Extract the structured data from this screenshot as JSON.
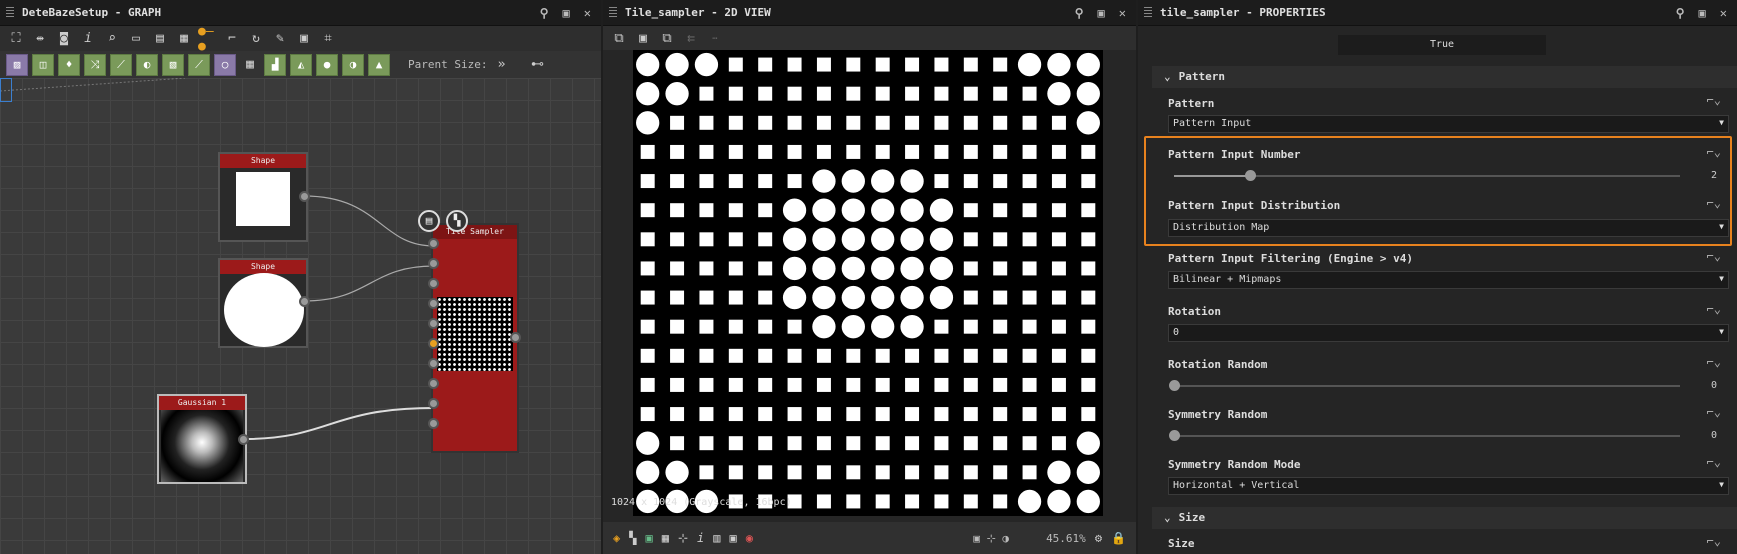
{
  "graph": {
    "title": "DeteBazeSetup - GRAPH",
    "parent_size": "Parent Size:",
    "nodes": {
      "shape1": "Shape",
      "shape2": "Shape",
      "gaussian": "Gaussian 1",
      "tile_sampler": "Tile Sampler"
    }
  },
  "view": {
    "title": "Tile_sampler - 2D VIEW",
    "resolution": "1024 x 1024 (Grayscale, 16bpc)",
    "zoom": "45.61%"
  },
  "props": {
    "title": "tile_sampler - PROPERTIES",
    "top_value": "True",
    "section_pattern": "Pattern",
    "pattern_label": "Pattern",
    "pattern_value": "Pattern Input",
    "input_number_label": "Pattern Input Number",
    "input_number_value": "2",
    "input_number_fraction": 0.15,
    "distribution_label": "Pattern Input Distribution",
    "distribution_value": "Distribution Map",
    "filtering_label": "Pattern Input Filtering (Engine > v4)",
    "filtering_value": "Bilinear + Mipmaps",
    "rotation_label": "Rotation",
    "rotation_value": "0",
    "rotation_random_label": "Rotation Random",
    "rotation_random_value": "0",
    "symmetry_random_label": "Symmetry Random",
    "symmetry_random_value": "0",
    "symmetry_mode_label": "Symmetry Random Mode",
    "symmetry_mode_value": "Horizontal + Vertical",
    "section_size": "Size",
    "size_label": "Size"
  },
  "colors": {
    "node_header": "#9c1a1a",
    "highlight": "#e8821e",
    "filter_icon": "#7a9a5a"
  }
}
